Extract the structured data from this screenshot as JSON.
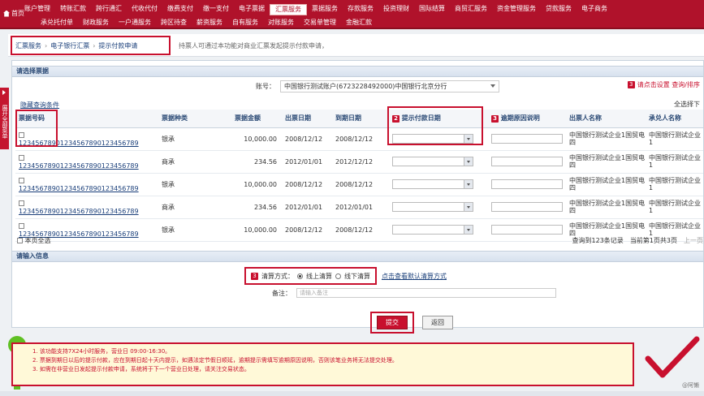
{
  "nav": {
    "home": "首页",
    "row1": [
      "账户管理",
      "转账汇款",
      "跨行通汇",
      "代收代付",
      "缴费支付",
      "缴一支付",
      "电子票据",
      "汇票服务",
      "票据服务",
      "存款服务",
      "投资理财",
      "国际结算",
      "商贸汇服务",
      "资金管理服务",
      "贷款服务",
      "电子商务"
    ],
    "row2": [
      "承兑托付单",
      "财政服务",
      "一户通服务",
      "跨区待查",
      "薪资服务",
      "自有服务",
      "对账服务",
      "交易单管理",
      "金融汇款"
    ],
    "active_index": 7
  },
  "sidetab": "展开全部菜单",
  "breadcrumb": {
    "items": [
      "汇票服务",
      "电子银行汇票",
      "提示付款申请"
    ],
    "separator": "›",
    "tip": "持票人可通过本功能对商业汇票发起提示付款申请，"
  },
  "section1_title": "请选择票据",
  "account": {
    "label": "账号：",
    "value": "中国银行测试账户(6723228492000)中国银行北京分行"
  },
  "right_links": {
    "badge": "3",
    "text": "请点击设置 查询/排序"
  },
  "hide_conditions": "隐藏查询条件",
  "select_all_top": "全选择下",
  "table": {
    "headers": [
      "票据号码",
      "票据种类",
      "票据金额",
      "出票日期",
      "到期日期",
      "提示付款日期",
      "逾期原因说明",
      "出票人名称",
      "承兑人名称"
    ],
    "header_badges": {
      "5": "2",
      "6": "3"
    },
    "rows": [
      {
        "no": "12345678901234567890123456789",
        "kind": "银承",
        "amount": "10,000.00",
        "issue": "2008/12/12",
        "due": "2008/12/12",
        "drawer": "中国银行测试企业1国贸电四",
        "acceptor": "中国银行测试企业1"
      },
      {
        "no": "12345678901234567890123456789",
        "kind": "商承",
        "amount": "234.56",
        "issue": "2012/01/01",
        "due": "2012/12/12",
        "drawer": "中国银行测试企业1国贸电四",
        "acceptor": "中国银行测试企业1"
      },
      {
        "no": "12345678901234567890123456789",
        "kind": "银承",
        "amount": "10,000.00",
        "issue": "2008/12/12",
        "due": "2008/12/12",
        "drawer": "中国银行测试企业1国贸电四",
        "acceptor": "中国银行测试企业1"
      },
      {
        "no": "12345678901234567890123456789",
        "kind": "商承",
        "amount": "234.56",
        "issue": "2012/01/01",
        "due": "2012/01/01",
        "drawer": "中国银行测试企业1国贸电四",
        "acceptor": "中国银行测试企业1"
      },
      {
        "no": "12345678901234567890123456789",
        "kind": "银承",
        "amount": "10,000.00",
        "issue": "2008/12/12",
        "due": "2008/12/12",
        "drawer": "中国银行测试企业1国贸电四",
        "acceptor": "中国银行测试企业1"
      }
    ]
  },
  "table_footer": {
    "select_page": "本页全选",
    "records": "查询到123条记录",
    "pages": "当前第1页共3页",
    "prev": "上一页"
  },
  "section2_title": "请输入信息",
  "settle": {
    "badge": "3",
    "label": "清算方式：",
    "online": "线上清算",
    "offline": "线下清算",
    "link": "点击查看默认清算方式"
  },
  "note": {
    "label": "备注：",
    "placeholder": "请输入备注"
  },
  "buttons": {
    "submit": "提交",
    "back": "返回"
  },
  "notice_lines": [
    "1. 该功能支持7X24小时服务，营业日 09:00-16:30。",
    "2. 票据到期日以后的提示付款，应在到期日起十天内提示，如遇法定节假日顺延，逾期提示需填写逾期原因说明，否则该笔业务将无法提交处理。",
    "3. 如需在非营业日发起提示付款申请，系统将于下一个营业日处理，请关注交易状态。"
  ],
  "watermark": "@阿懒",
  "colors": {
    "brand": "#b0122b",
    "highlight": "#c8102e",
    "ok": "#5fc023"
  }
}
